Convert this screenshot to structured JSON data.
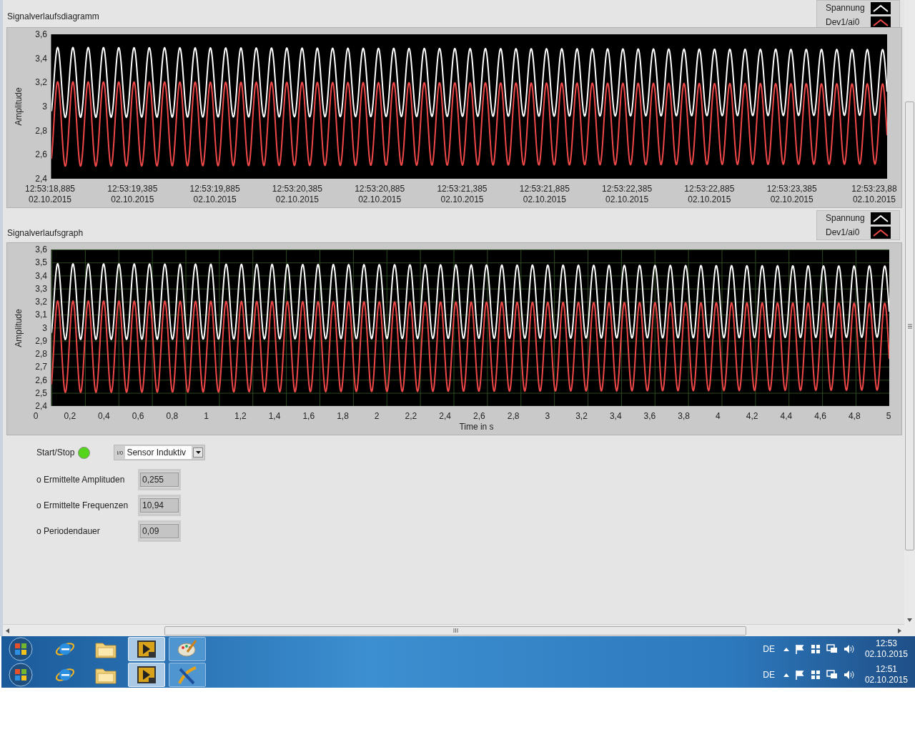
{
  "charts": [
    {
      "title": "Signalverlaufsdiagramm",
      "grid": false,
      "y_label": "Amplitude",
      "legend": [
        {
          "name": "Spannung",
          "color": "#ffffff"
        },
        {
          "name": "Dev1/ai0",
          "color": "#f04848"
        }
      ],
      "y_ticks": [
        "3,6",
        "3,4",
        "3,2",
        "3",
        "2,8",
        "2,6",
        "2,4"
      ],
      "x_ticks": [
        {
          "time": "12:53:18,885",
          "date": "02.10.2015"
        },
        {
          "time": "12:53:19,385",
          "date": "02.10.2015"
        },
        {
          "time": "12:53:19,885",
          "date": "02.10.2015"
        },
        {
          "time": "12:53:20,385",
          "date": "02.10.2015"
        },
        {
          "time": "12:53:20,885",
          "date": "02.10.2015"
        },
        {
          "time": "12:53:21,385",
          "date": "02.10.2015"
        },
        {
          "time": "12:53:21,885",
          "date": "02.10.2015"
        },
        {
          "time": "12:53:22,385",
          "date": "02.10.2015"
        },
        {
          "time": "12:53:22,885",
          "date": "02.10.2015"
        },
        {
          "time": "12:53:23,385",
          "date": "02.10.2015"
        },
        {
          "time": "12:53:23,88",
          "date": "02.10.2015"
        }
      ]
    },
    {
      "title": "Signalverlaufsgraph",
      "grid": true,
      "y_label": "Amplitude",
      "x_label": "Time in s",
      "legend": [
        {
          "name": "Spannung",
          "color": "#ffffff"
        },
        {
          "name": "Dev1/ai0",
          "color": "#f04848"
        }
      ],
      "y_ticks": [
        "3,6",
        "3,5",
        "3,4",
        "3,3",
        "3,2",
        "3,1",
        "3",
        "2,9",
        "2,8",
        "2,7",
        "2,6",
        "2,5",
        "2,4"
      ],
      "x_ticks": [
        "0",
        "0,2",
        "0,4",
        "0,6",
        "0,8",
        "1",
        "1,2",
        "1,4",
        "1,6",
        "1,8",
        "2",
        "2,2",
        "2,4",
        "2,6",
        "2,8",
        "3",
        "3,2",
        "3,4",
        "3,6",
        "3,8",
        "4",
        "4,2",
        "4,4",
        "4,6",
        "4,8",
        "5"
      ]
    }
  ],
  "start_stop": {
    "label": "Start/Stop",
    "on": true
  },
  "sensor_select": {
    "glyph": "I/0",
    "value": "Sensor Induktiv"
  },
  "indicators": [
    {
      "label": "o Ermittelte Amplituden",
      "value": "0,255"
    },
    {
      "label": "o Ermittelte Frequenzen",
      "value": "10,94"
    },
    {
      "label": "o Periodendauer",
      "value": "0,09"
    }
  ],
  "taskbars": [
    {
      "language": "DE",
      "time": "12:53",
      "date": "02.10.2015",
      "apps": [
        {
          "kind": "browser",
          "active": false
        },
        {
          "kind": "folder",
          "active": false
        },
        {
          "kind": "labview",
          "active": true
        },
        {
          "kind": "paint",
          "active": false
        }
      ]
    },
    {
      "language": "DE",
      "time": "12:51",
      "date": "02.10.2015",
      "apps": [
        {
          "kind": "browser",
          "active": false
        },
        {
          "kind": "folder",
          "active": false
        },
        {
          "kind": "labview",
          "active": true
        },
        {
          "kind": "tool",
          "active": false
        }
      ]
    }
  ]
}
